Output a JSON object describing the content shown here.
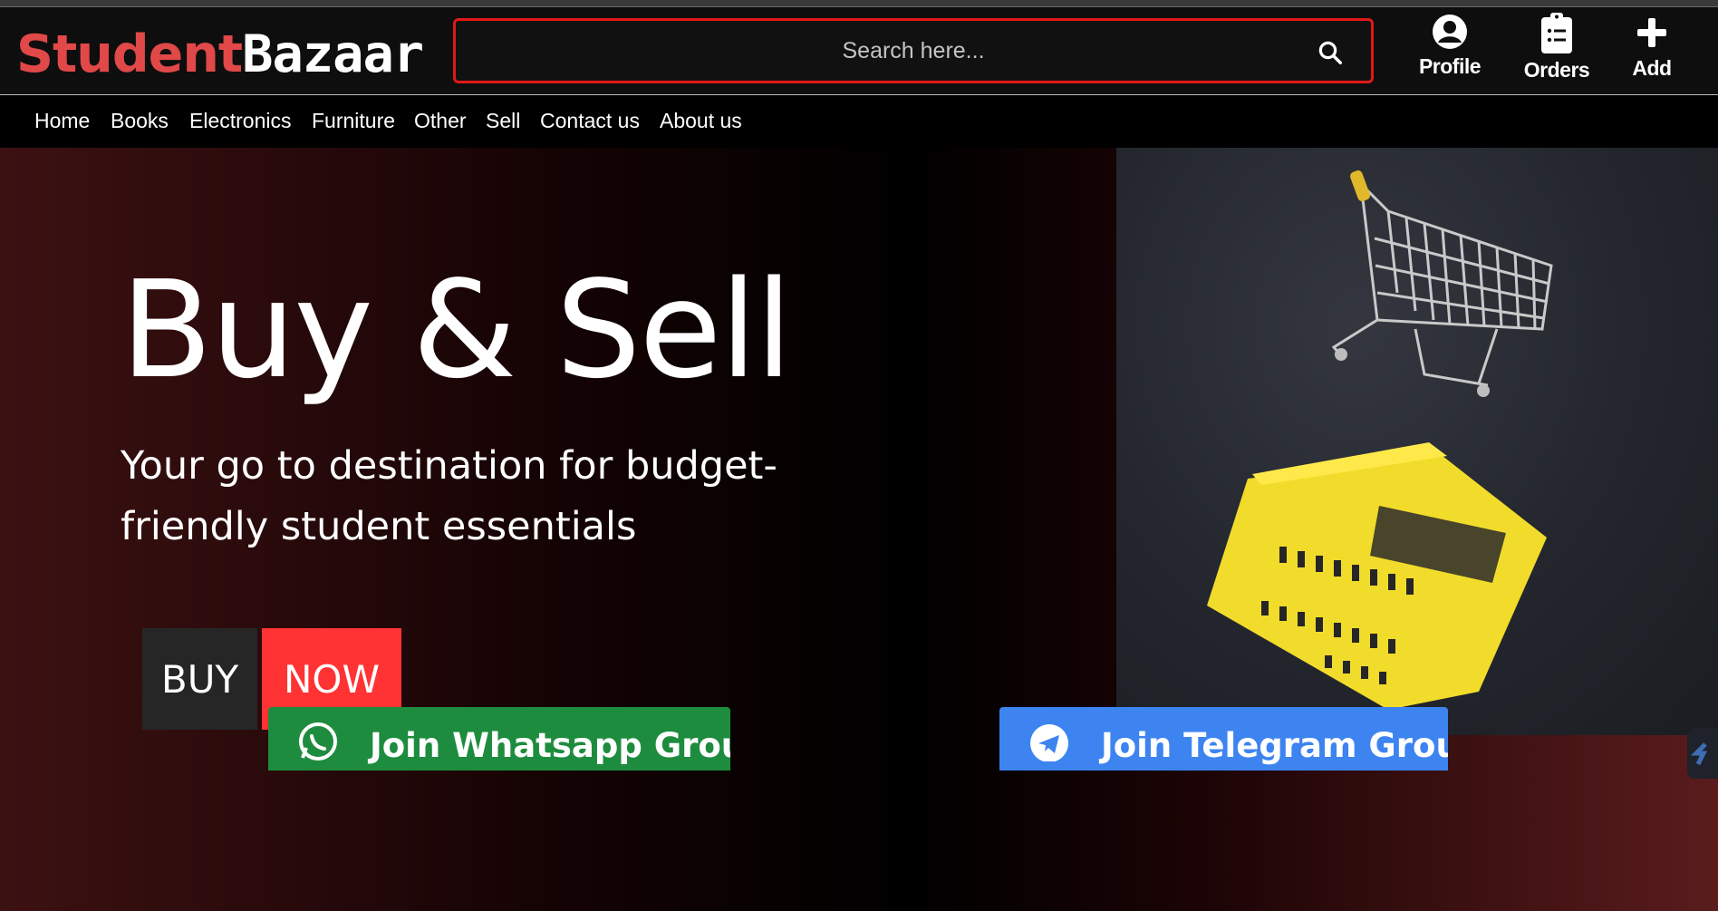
{
  "header": {
    "logo_part1": "Student",
    "logo_part2": "Bazaar",
    "search_placeholder": "Search here...",
    "profile_label": "Profile",
    "orders_label": "Orders",
    "add_label": "Add"
  },
  "nav": {
    "items": [
      "Home",
      "Books",
      "Electronics",
      "Furniture",
      "Other",
      "Sell",
      "Contact us",
      "About us"
    ]
  },
  "hero": {
    "title": "Buy & Sell",
    "subtitle": "Your go to destination for budget-friendly student essentials",
    "buy_label": "BUY",
    "now_label": "NOW"
  },
  "groups": {
    "whatsapp_label": "Join Whatsapp Group",
    "telegram_label": "Join Telegram Group"
  },
  "colors": {
    "brand_red": "#e14848",
    "search_border": "#e01818",
    "now_button": "#ff3333",
    "whatsapp_green": "#1e8c3e",
    "telegram_blue": "#3d84f0"
  },
  "icons": {
    "search": "search-icon",
    "profile": "user-circle-icon",
    "orders": "clipboard-list-icon",
    "add": "plus-icon",
    "whatsapp": "whatsapp-icon",
    "telegram": "telegram-icon"
  }
}
